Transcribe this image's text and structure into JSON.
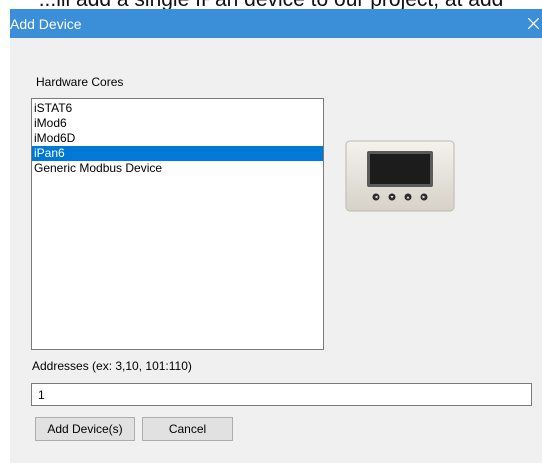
{
  "background_doc": {
    "text": "...ill add a single IPan device to our project, at add"
  },
  "dialog": {
    "title": "Add Device",
    "close_glyph": "✕",
    "title_bar_color": "#3b8ed8"
  },
  "hardware": {
    "label": "Hardware Cores",
    "items": [
      {
        "label": "iSTAT6",
        "selected": false
      },
      {
        "label": "iMod6",
        "selected": false
      },
      {
        "label": "iMod6D",
        "selected": false
      },
      {
        "label": "iPan6",
        "selected": true
      },
      {
        "label": "Generic Modbus Device",
        "selected": false
      }
    ],
    "selection_color": "#0078d7"
  },
  "preview": {
    "icon": "ipan6-device-image"
  },
  "addresses": {
    "label": "Addresses (ex: 3,10, 101:110)",
    "value": "1"
  },
  "buttons": {
    "add_label": "Add Device(s)",
    "cancel_label": "Cancel"
  }
}
